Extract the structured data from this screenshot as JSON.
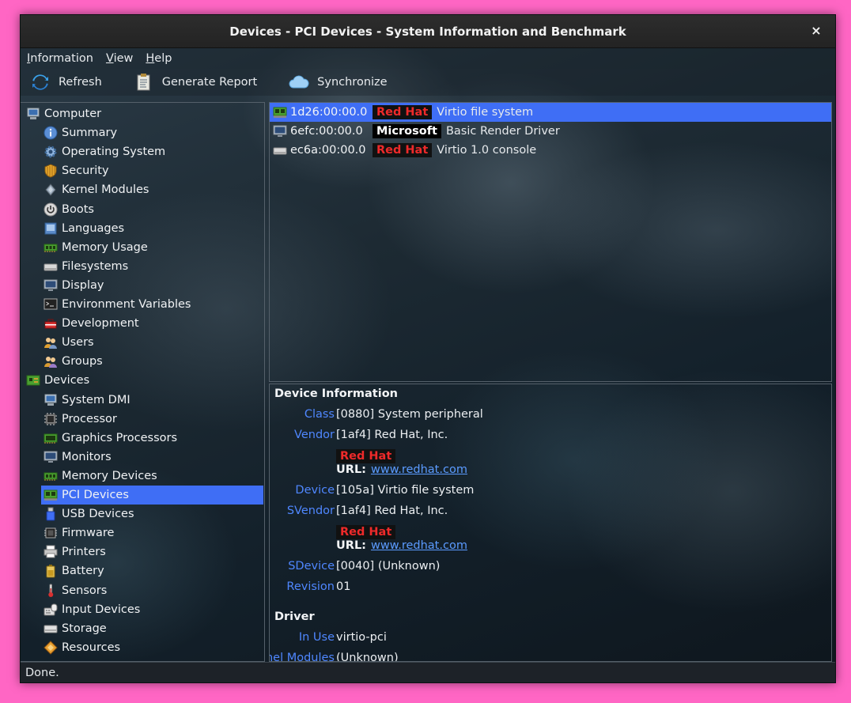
{
  "window": {
    "title": "Devices - PCI Devices - System Information and Benchmark",
    "close_glyph": "×"
  },
  "menu": [
    "Information",
    "View",
    "Help"
  ],
  "toolbar": {
    "refresh_label": "Refresh",
    "report_label": "Generate Report",
    "sync_label": "Synchronize"
  },
  "sidebar": {
    "items": [
      {
        "label": "Computer",
        "icon": "computer-icon",
        "level": 0
      },
      {
        "label": "Summary",
        "icon": "info-icon",
        "level": 1
      },
      {
        "label": "Operating System",
        "icon": "gear-icon",
        "level": 1
      },
      {
        "label": "Security",
        "icon": "shield-icon",
        "level": 1
      },
      {
        "label": "Kernel Modules",
        "icon": "module-icon",
        "level": 1
      },
      {
        "label": "Boots",
        "icon": "power-icon",
        "level": 1
      },
      {
        "label": "Languages",
        "icon": "language-icon",
        "level": 1
      },
      {
        "label": "Memory Usage",
        "icon": "memory-icon",
        "level": 1
      },
      {
        "label": "Filesystems",
        "icon": "drive-icon",
        "level": 1
      },
      {
        "label": "Display",
        "icon": "monitor-icon",
        "level": 1
      },
      {
        "label": "Environment Variables",
        "icon": "terminal-icon",
        "level": 1
      },
      {
        "label": "Development",
        "icon": "toolbox-icon",
        "level": 1
      },
      {
        "label": "Users",
        "icon": "users-icon",
        "level": 1
      },
      {
        "label": "Groups",
        "icon": "groups-icon",
        "level": 1
      },
      {
        "label": "Devices",
        "icon": "board-icon",
        "level": 0
      },
      {
        "label": "System DMI",
        "icon": "computer-icon",
        "level": 1
      },
      {
        "label": "Processor",
        "icon": "cpu-icon",
        "level": 1
      },
      {
        "label": "Graphics Processors",
        "icon": "gpu-icon",
        "level": 1
      },
      {
        "label": "Monitors",
        "icon": "monitor-icon",
        "level": 1
      },
      {
        "label": "Memory Devices",
        "icon": "memory-icon",
        "level": 1
      },
      {
        "label": "PCI Devices",
        "icon": "pci-icon",
        "level": 1,
        "selected": true
      },
      {
        "label": "USB Devices",
        "icon": "usb-icon",
        "level": 1
      },
      {
        "label": "Firmware",
        "icon": "chip-icon",
        "level": 1
      },
      {
        "label": "Printers",
        "icon": "printer-icon",
        "level": 1
      },
      {
        "label": "Battery",
        "icon": "battery-icon",
        "level": 1
      },
      {
        "label": "Sensors",
        "icon": "thermometer-icon",
        "level": 1
      },
      {
        "label": "Input Devices",
        "icon": "keyboard-icon",
        "level": 1
      },
      {
        "label": "Storage",
        "icon": "storage-icon",
        "level": 1
      },
      {
        "label": "Resources",
        "icon": "resources-icon",
        "level": 1
      }
    ]
  },
  "devices": [
    {
      "addr": "1d26:00:00.0",
      "vendor": "Red Hat",
      "vendor_style": "redhat",
      "name": "Virtio file system",
      "icon": "pci-icon",
      "selected": true
    },
    {
      "addr": "6efc:00:00.0",
      "vendor": "Microsoft",
      "vendor_style": "ms",
      "name": "Basic Render Driver",
      "icon": "monitor-icon"
    },
    {
      "addr": "ec6a:00:00.0",
      "vendor": "Red Hat",
      "vendor_style": "redhat",
      "name": "Virtio 1.0 console",
      "icon": "drive-icon"
    }
  ],
  "details": {
    "device_info_title": "Device Information",
    "class_key": "Class",
    "class_val": "[0880] System peripheral",
    "vendor_key": "Vendor",
    "vendor_val": "[1af4] Red Hat, Inc.",
    "vendor_badge": "Red Hat",
    "url_label": "URL:",
    "vendor_url": "www.redhat.com",
    "device_key": "Device",
    "device_val": "[105a] Virtio file system",
    "svendor_key": "SVendor",
    "svendor_val": "[1af4] Red Hat, Inc.",
    "svendor_badge": "Red Hat",
    "svendor_url": "www.redhat.com",
    "sdevice_key": "SDevice",
    "sdevice_val": "[0040] (Unknown)",
    "revision_key": "Revision",
    "revision_val": "01",
    "driver_title": "Driver",
    "inuse_key": "In Use",
    "inuse_val": "virtio-pci",
    "kmod_key": "Kernel Modules",
    "kmod_val": "(Unknown)"
  },
  "status": "Done.",
  "colors": {
    "selection": "#3f6ef5",
    "key_blue": "#4f87ff",
    "redhat_red": "#ee2a2a",
    "frame": "#ff66c4"
  }
}
